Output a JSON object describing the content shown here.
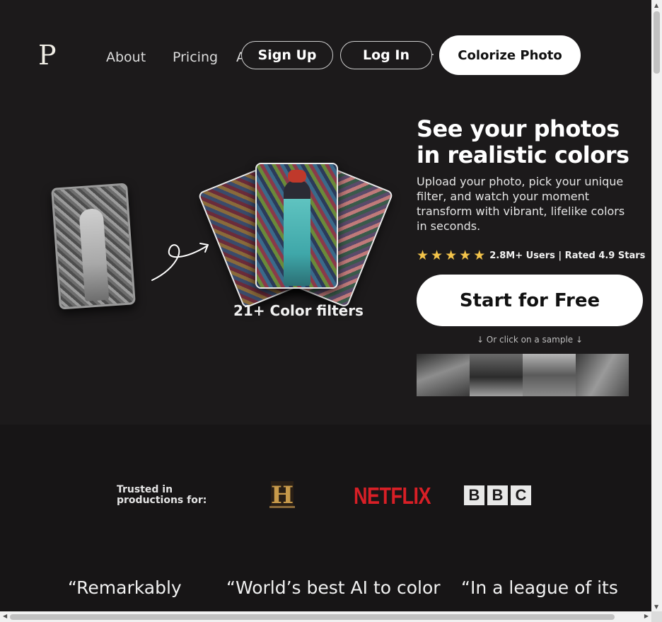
{
  "nav": {
    "logo": "P",
    "links": [
      "About",
      "Pricing",
      "A",
      "r"
    ],
    "sign_up": "Sign Up",
    "log_in": "Log In",
    "colorize": "Colorize Photo"
  },
  "hero": {
    "filters_label": "21+ Color filters",
    "title": "See your photos in realistic colors",
    "description": "Upload your photo, pick your unique filter, and watch your moment transform with vibrant, lifelike colors in seconds.",
    "rating_stars": 5,
    "star_glyph": "★",
    "rating_text": "2.8M+ Users | Rated 4.9 Stars",
    "cta": "Start for Free",
    "sample_hint": "↓ Or click on a sample ↓"
  },
  "trusted": {
    "label": "Trusted in productions for:",
    "logos": [
      "history-logo",
      "NETFLIX",
      "BBC"
    ],
    "netflix": "NETFLIX",
    "bbc": [
      "B",
      "B",
      "C"
    ],
    "history_letter": "H"
  },
  "quotes": [
    "“Remarkably",
    "“World’s best AI to color",
    "“In a league of its"
  ],
  "colors": {
    "background": "#1c1a1b",
    "star": "#f4c44a",
    "netflix_red": "#d81f26",
    "cta_bg": "#ffffff"
  }
}
